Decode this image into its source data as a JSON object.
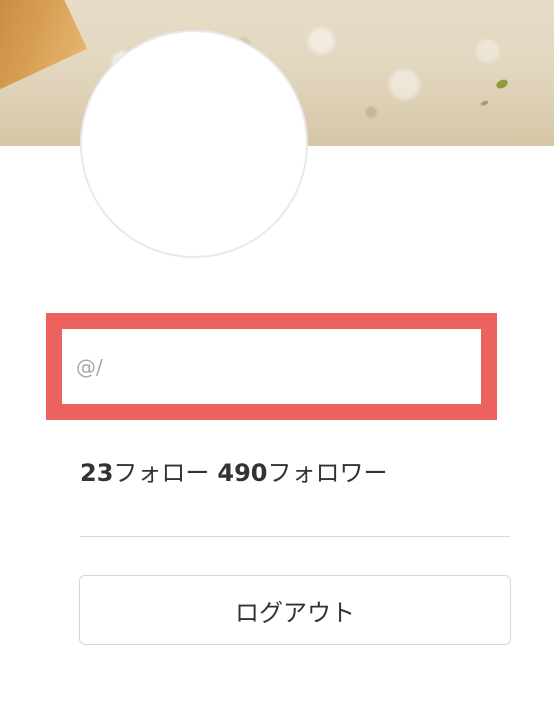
{
  "profile": {
    "handle_input": {
      "value": "@/"
    },
    "stats": {
      "follow_count": "23",
      "follow_label": "フォロー",
      "follower_count": "490",
      "follower_label": "フォロワー"
    },
    "logout_label": "ログアウト"
  },
  "colors": {
    "highlight_border": "#eb625f",
    "divider": "#d9d9d9",
    "button_border": "#d7d7d7",
    "text": "#333333",
    "muted_text": "#a9a9a9"
  },
  "icons": {
    "avatar": "profile-avatar"
  }
}
